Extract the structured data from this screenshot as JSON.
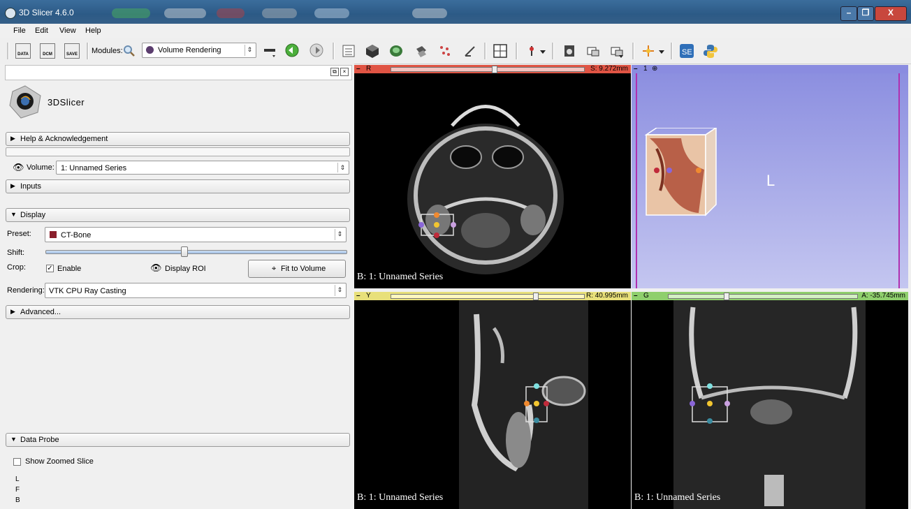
{
  "window": {
    "title": "3D Slicer 4.6.0",
    "minimize": "–",
    "maximize": "❐",
    "close": "X"
  },
  "menu": [
    "File",
    "Edit",
    "View",
    "Help"
  ],
  "toolbar": {
    "data_label": "DATA",
    "dcm_label": "DCM",
    "save_label": "SAVE",
    "modules_label": "Modules:",
    "module_selected": "Volume Rendering"
  },
  "panel": {
    "logo_text": "3DSlicer",
    "help_section": "Help & Acknowledgement",
    "volume_label": "Volume:",
    "volume_value": "1: Unnamed Series",
    "inputs_section": "Inputs",
    "display_section": "Display",
    "preset_label": "Preset:",
    "preset_value": "CT-Bone",
    "shift_label": "Shift:",
    "shift_value": 0.46,
    "crop_label": "Crop:",
    "enable_label": "Enable",
    "enable_checked": "✓",
    "display_roi_label": "Display ROI",
    "fit_button": "Fit to Volume",
    "rendering_label": "Rendering:",
    "rendering_value": "VTK CPU Ray Casting",
    "advanced_section": "Advanced...",
    "data_probe_section": "Data Probe",
    "show_zoomed_label": "Show Zoomed Slice",
    "probe_lines": [
      "L",
      "F",
      "B"
    ]
  },
  "views": {
    "red": {
      "letter": "R",
      "value": "S: 9.272mm",
      "label": "B: 1: Unnamed Series",
      "color": "#e05444"
    },
    "threed": {
      "letter": "1",
      "orientation": "L",
      "color": "#8a8ce0"
    },
    "yellow": {
      "letter": "Y",
      "value": "R: 40.995mm",
      "label": "B: 1: Unnamed Series",
      "color": "#e8e07a"
    },
    "green": {
      "letter": "G",
      "value": "A: -35.745mm",
      "label": "B: 1: Unnamed Series",
      "color": "#8fcf6d"
    }
  }
}
